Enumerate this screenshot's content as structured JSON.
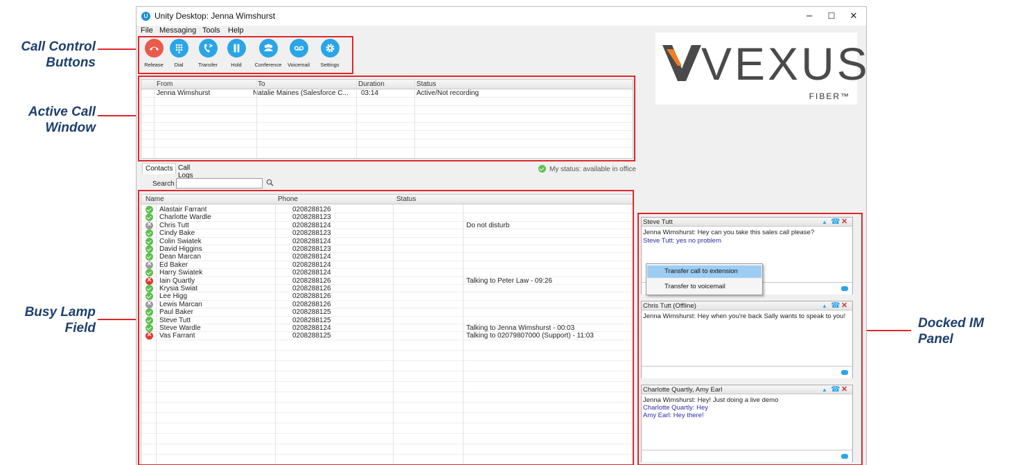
{
  "annotations": {
    "call_control": [
      "Call Control",
      "Buttons"
    ],
    "active_call": [
      "Active Call",
      "Window"
    ],
    "busy_lamp": [
      "Busy Lamp",
      "Field"
    ],
    "docked_im": [
      "Docked IM",
      "Panel"
    ]
  },
  "window": {
    "title": "Unity Desktop: Jenna Wimshurst",
    "minimize": "–",
    "maximize": "☐",
    "close": "✕"
  },
  "menu": [
    "File",
    "Messaging",
    "Tools",
    "Help"
  ],
  "toolbar": [
    {
      "label": "Release",
      "icon": "phone-hangup-icon",
      "color": "#ea5b4c"
    },
    {
      "label": "Dial",
      "icon": "dialpad-icon",
      "color": "#2aa5e8"
    },
    {
      "label": "Transfer",
      "icon": "transfer-icon",
      "color": "#2aa5e8"
    },
    {
      "label": "Hold",
      "icon": "pause-icon",
      "color": "#2aa5e8"
    },
    {
      "label": "Conference",
      "icon": "people-icon",
      "color": "#2aa5e8"
    },
    {
      "label": "Voicemail",
      "icon": "voicemail-icon",
      "color": "#2aa5e8"
    },
    {
      "label": "Settings",
      "icon": "gear-icon",
      "color": "#2aa5e8"
    }
  ],
  "active_calls": {
    "columns": [
      "From",
      "To",
      "Duration",
      "Status"
    ],
    "rows": [
      [
        "Jenna Wimshurst",
        "Natalie Maines (Salesforce C...",
        "03:14",
        "Active/Not recording"
      ]
    ]
  },
  "tabs": [
    "Contacts",
    "Call Logs"
  ],
  "my_status": "My status: available in office",
  "search": {
    "label": "Search",
    "value": ""
  },
  "contacts": {
    "columns": [
      "Name",
      "Phone",
      "Status"
    ],
    "rows": [
      {
        "name": "Alastair Farrant",
        "phone": "0208288126",
        "status": "",
        "state": "available"
      },
      {
        "name": "Charlotte Wardle",
        "phone": "0208288123",
        "status": "",
        "state": "available"
      },
      {
        "name": "Chris Tutt",
        "phone": "0208288124",
        "status": "Do not disturb",
        "state": "offline"
      },
      {
        "name": "Cindy Bake",
        "phone": "0208288123",
        "status": "",
        "state": "available"
      },
      {
        "name": "Colin Swiatek",
        "phone": "0208288124",
        "status": "",
        "state": "available"
      },
      {
        "name": "David Higgins",
        "phone": "0208288123",
        "status": "",
        "state": "available"
      },
      {
        "name": "Dean Marcan",
        "phone": "0208288124",
        "status": "",
        "state": "available"
      },
      {
        "name": "Ed Baker",
        "phone": "0208288124",
        "status": "",
        "state": "offline"
      },
      {
        "name": "Harry Swiatek",
        "phone": "0208288124",
        "status": "",
        "state": "available"
      },
      {
        "name": "Iain Quartly",
        "phone": "0208288126",
        "status": "Talking to Peter Law - 09:26",
        "state": "busy"
      },
      {
        "name": "Krysia Swiat",
        "phone": "0208288126",
        "status": "",
        "state": "available"
      },
      {
        "name": "Lee Higg",
        "phone": "0208288126",
        "status": "",
        "state": "available"
      },
      {
        "name": "Lewis Marcan",
        "phone": "0208288126",
        "status": "",
        "state": "offline"
      },
      {
        "name": "Paul Baker",
        "phone": "0208288125",
        "status": "",
        "state": "available"
      },
      {
        "name": "Steve Tutt",
        "phone": "0208288125",
        "status": "",
        "state": "available"
      },
      {
        "name": "Steve Wardle",
        "phone": "0208288124",
        "status": "Talking to Jenna Wimshurst - 00:03",
        "state": "available"
      },
      {
        "name": "Vas Farrant",
        "phone": "0208288125",
        "status": "Talking to 02079807000 (Support) - 11:03",
        "state": "busy"
      }
    ]
  },
  "logo": {
    "brand": "VEXUS",
    "sub": "FIBER™",
    "accent": "#f07d22"
  },
  "im_panels": [
    {
      "title": "Steve Tutt",
      "messages": [
        {
          "text": "Jenna Wimshurst: Hey can you take this sales call please?",
          "style": "normal"
        },
        {
          "text": "Steve Tutt: yes no problem",
          "style": "blue"
        }
      ]
    },
    {
      "title": "Chris Tutt (Offline)",
      "messages": [
        {
          "text": "Jenna Wimshurst: Hey when you're back Sally wants to speak to you!",
          "style": "normal"
        }
      ]
    },
    {
      "title": "Charlotte Quartly, Amy Earl",
      "messages": [
        {
          "text": "Jenna Wimshurst: Hey! Just doing a live demo",
          "style": "normal"
        },
        {
          "text": "Charlotte Quartly: Hey",
          "style": "blue"
        },
        {
          "text": "Amy Earl: Hey there!",
          "style": "blue"
        }
      ]
    }
  ],
  "context_menu": [
    "Transfer call to extension",
    "Transfer to voicemail"
  ],
  "colors": {
    "annotation": "#1c3f6e",
    "highlight": "#e0262a",
    "button": "#2aa5e8",
    "release": "#ea5b4c"
  }
}
